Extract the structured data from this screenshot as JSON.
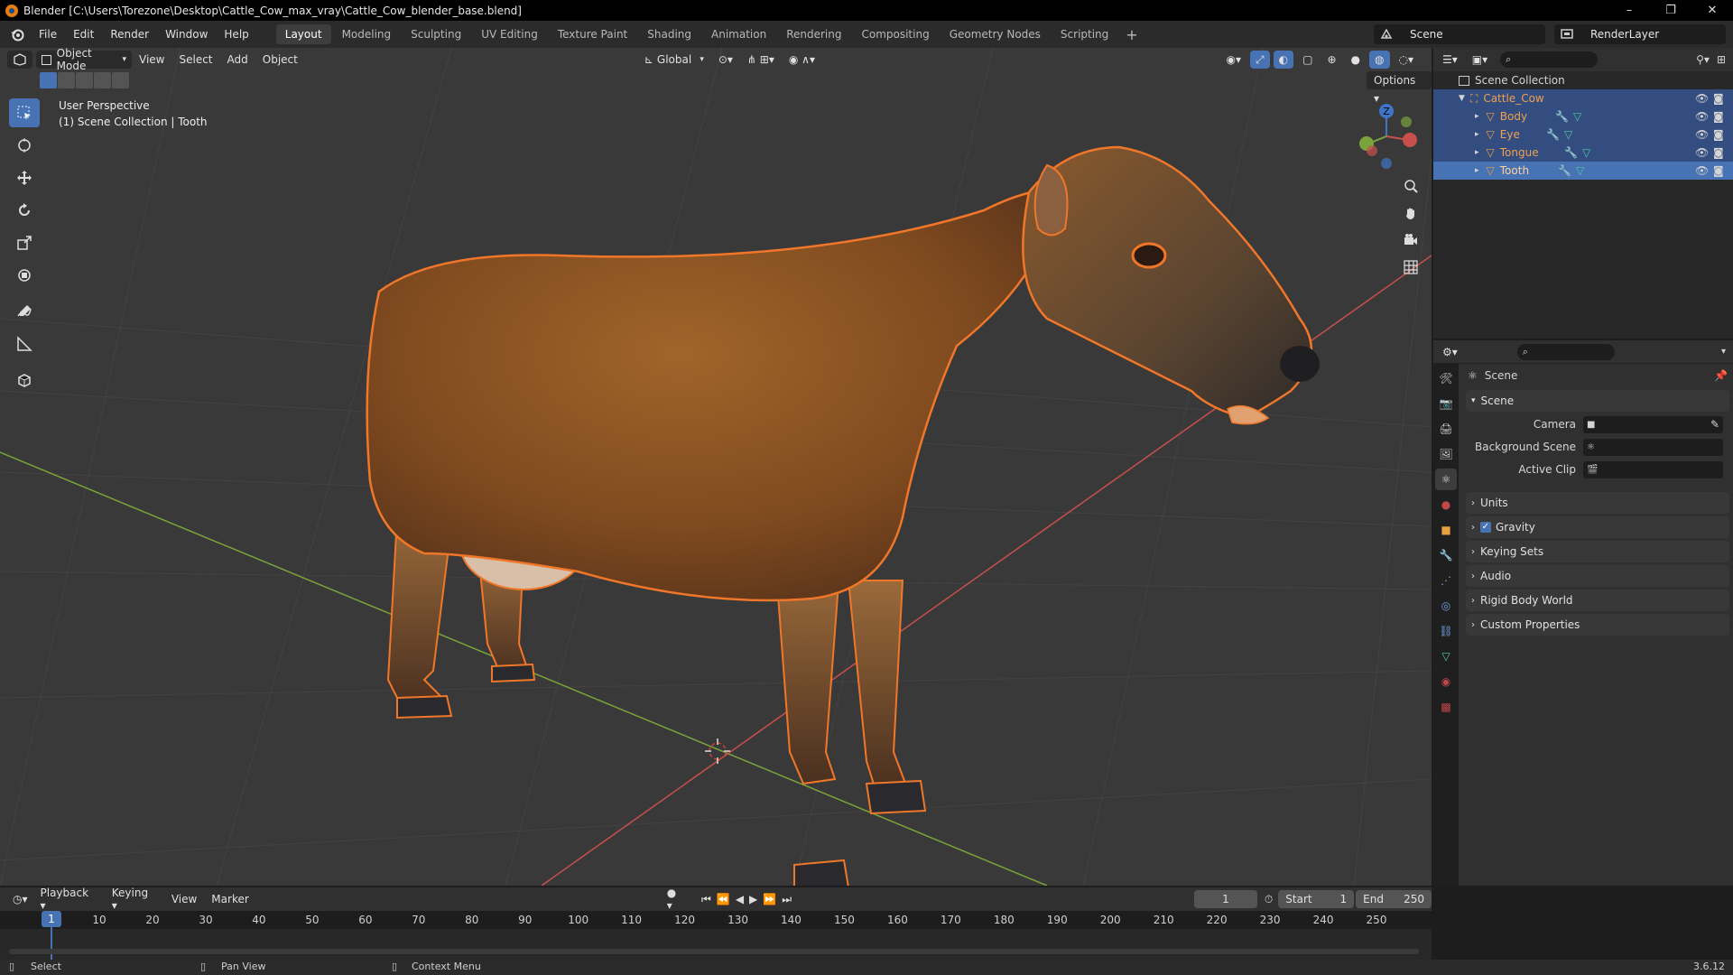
{
  "titlebar": {
    "title": "Blender [C:\\Users\\Torezone\\Desktop\\Cattle_Cow_max_vray\\Cattle_Cow_blender_base.blend]",
    "minimize": "–",
    "maximize": "❐",
    "close": "✕"
  },
  "menu": {
    "items": [
      "File",
      "Edit",
      "Render",
      "Window",
      "Help"
    ],
    "workspaces": [
      "Layout",
      "Modeling",
      "Sculpting",
      "UV Editing",
      "Texture Paint",
      "Shading",
      "Animation",
      "Rendering",
      "Compositing",
      "Geometry Nodes",
      "Scripting"
    ],
    "add_workspace": "+",
    "scene": "Scene",
    "view_layer": "RenderLayer"
  },
  "viewport": {
    "mode": "Object Mode",
    "menus": [
      "View",
      "Select",
      "Add",
      "Object"
    ],
    "transform_orientation": "Global",
    "options_label": "Options",
    "perspective_label": "User Perspective",
    "collection_label": "(1) Scene Collection | Tooth",
    "gizmo_axes": {
      "x": "X",
      "y": "Y",
      "z": "Z"
    },
    "colors": {
      "background": "#393939",
      "grid": "#444444",
      "x_axis": "#c8504a",
      "y_axis": "#7aa33a",
      "selection_outline": "#f0772a"
    }
  },
  "outliner": {
    "root": "Scene Collection",
    "collection": "Cattle_Cow",
    "objects": [
      {
        "name": "Body",
        "selected": false
      },
      {
        "name": "Eye",
        "selected": false
      },
      {
        "name": "Tongue",
        "selected": false
      },
      {
        "name": "Tooth",
        "selected": true
      }
    ]
  },
  "properties": {
    "context_title": "Scene",
    "panel_title": "Scene",
    "fields": [
      {
        "label": "Camera",
        "value": ""
      },
      {
        "label": "Background Scene",
        "value": ""
      },
      {
        "label": "Active Clip",
        "value": ""
      }
    ],
    "subpanels": [
      "Units",
      "Gravity",
      "Keying Sets",
      "Audio",
      "Rigid Body World",
      "Custom Properties"
    ],
    "gravity_checked": true
  },
  "timeline": {
    "menus": [
      "Playback",
      "Keying",
      "View",
      "Marker"
    ],
    "current_frame": "1",
    "start_label": "Start",
    "start_value": "1",
    "end_label": "End",
    "end_value": "250",
    "ticks": [
      "1",
      "10",
      "20",
      "30",
      "40",
      "50",
      "60",
      "70",
      "80",
      "90",
      "100",
      "110",
      "120",
      "130",
      "140",
      "150",
      "160",
      "170",
      "180",
      "190",
      "200",
      "210",
      "220",
      "230",
      "240",
      "250"
    ]
  },
  "statusbar": {
    "select": "Select",
    "pan_view": "Pan View",
    "context_menu": "Context Menu",
    "version": "3.6.12"
  }
}
